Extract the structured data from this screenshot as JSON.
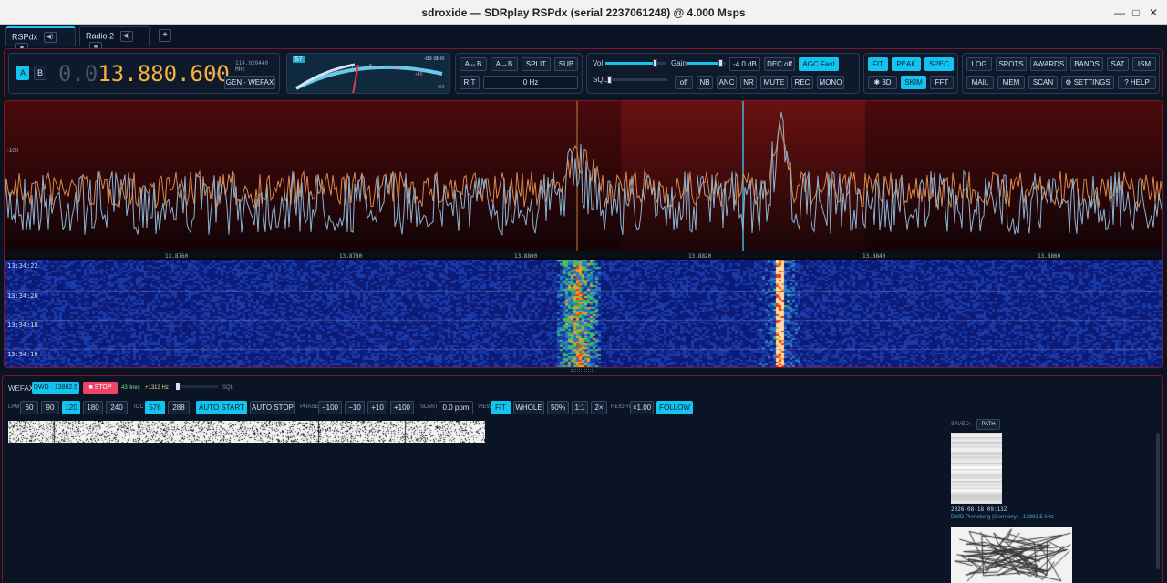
{
  "window": {
    "title": "sdroxide — SDRplay RSPdx (serial 2237061248) @ 4.000 Msps",
    "minimize": "—",
    "maximize": "□",
    "close": "✕"
  },
  "tabs": [
    {
      "label": "RSPdx",
      "active": true
    },
    {
      "label": "Radio 2",
      "active": false
    }
  ],
  "tab_add": "+",
  "vfo": {
    "a_label": "A",
    "b_label": "B",
    "freq_dim": "0.0",
    "freq_lit": "13.880.600",
    "unit": "Hz",
    "sub_freq": "114.028440 MHz",
    "mode": "GEN · WEFAX"
  },
  "smeter": {
    "badge": "S7",
    "level": "-83 dBm",
    "scale": [
      "1",
      "3",
      "5",
      "7",
      "9",
      "+20",
      "+40",
      "+60"
    ]
  },
  "vfo_ops": {
    "ab_swap": "A⇔B",
    "a_to_b": "A→B",
    "split": "SPLIT",
    "sub": "SUB",
    "rit": "RIT",
    "rit_value": "0 Hz"
  },
  "audio": {
    "vol_label": "Vol",
    "gain_label": "Gain",
    "gain_value": "-4.0 dB",
    "dec": "DEC off",
    "agc": "AGC Fast",
    "sql_label": "SQL",
    "off": "off",
    "nb": "NB",
    "anc": "ANC",
    "nr": "NR",
    "mute": "MUTE",
    "rec": "REC",
    "mono": "MONO"
  },
  "view": {
    "fit": "FIT",
    "peak": "PEAK",
    "spec": "SPEC",
    "three_d": "✱ 3D",
    "skim": "SKIM",
    "fft": "FFT"
  },
  "menu": {
    "row1": [
      "LOG",
      "SPOTS",
      "AWARDS",
      "BANDS",
      "SAT",
      "ISM"
    ],
    "row2": [
      "MAIL",
      "MEM",
      "SCAN",
      "⚙ SETTINGS",
      "? HELP"
    ]
  },
  "spectrum": {
    "ref_label": "-100",
    "freq_ticks": [
      "13.8760",
      "13.8780",
      "13.8800",
      "13.8820",
      "13.8840",
      "13.8860"
    ],
    "timestamps": [
      "13:34:22",
      "13:34:20",
      "13:34:18",
      "13:34:16"
    ]
  },
  "wefax": {
    "label": "WEFAX",
    "station": "DWD · 13882.5",
    "stop": "■ STOP",
    "lines": "43 lines",
    "offset": "+1313 Hz",
    "sql": "SQL",
    "lpm_label": "LPM",
    "lpm": [
      "60",
      "90",
      "120",
      "180",
      "240"
    ],
    "ioc_label": "IOC",
    "ioc": [
      "576",
      "288"
    ],
    "auto_start": "AUTO START",
    "auto_stop": "AUTO STOP",
    "phase_label": "PHASE",
    "phase": [
      "−100",
      "−10",
      "+10",
      "+100"
    ],
    "slant_label": "SLANT",
    "slant": "0.0 ppm",
    "view_label": "VIEW",
    "views": [
      "FIT",
      "WHOLE",
      "50%",
      "1:1",
      "2×"
    ],
    "height_label": "HEIGHT",
    "height": "×1.00",
    "follow": "FOLLOW",
    "saved_label": "SAVED",
    "saved_sep": ":",
    "path": "PATH",
    "saved_time": "2026-08-18 09:13Z",
    "saved_station": "DWD Pinneberg (Germany) · 13882.5 kHz"
  },
  "colors": {
    "accent": "#12c4f0",
    "alert": "#f0436a",
    "freq": "#f6b23a",
    "border_red": "#7a1626"
  }
}
